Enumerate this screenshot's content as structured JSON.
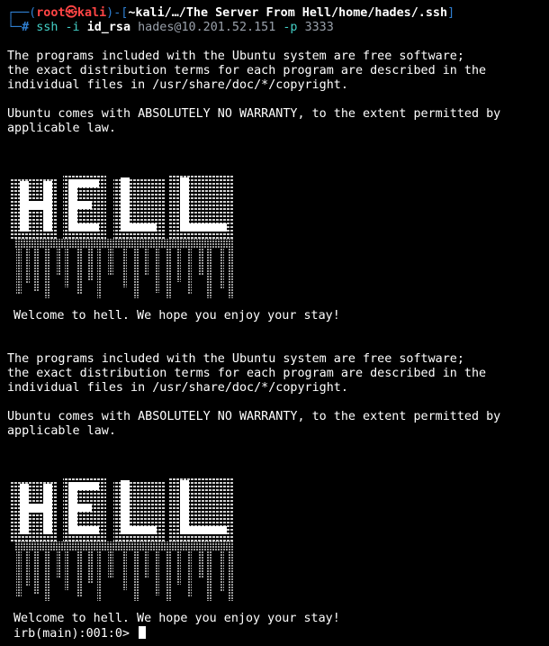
{
  "prompt": {
    "bracket_open": "┌──(",
    "user": "root㉿kali",
    "bracket_mid": ")-[",
    "path": "~kali/…/The Server From Hell/home/hades/.ssh",
    "bracket_close": "]",
    "second_line_prefix": "└─",
    "hash": "#",
    "command": "ssh",
    "flag_i": "-i",
    "key_file": "id_rsa",
    "target": "hades@10.201.52.151",
    "flag_p": "-p",
    "port": "3333"
  },
  "motd_1": {
    "line1": "The programs included with the Ubuntu system are free software;",
    "line2": "the exact distribution terms for each program are described in the",
    "line3": "individual files in /usr/share/doc/*/copyright.",
    "line4": "Ubuntu comes with ABSOLUTELY NO WARRANTY, to the extent permitted by",
    "line5": "applicable law."
  },
  "banner_1": {
    "text": "HELL",
    "welcome": "Welcome to hell. We hope you enjoy your stay!"
  },
  "motd_2": {
    "line1": "The programs included with the Ubuntu system are free software;",
    "line2": "the exact distribution terms for each program are described in the",
    "line3": "individual files in /usr/share/doc/*/copyright.",
    "line4": "Ubuntu comes with ABSOLUTELY NO WARRANTY, to the extent permitted by",
    "line5": "applicable law."
  },
  "banner_2": {
    "text": "HELL",
    "welcome": "Welcome to hell. We hope you enjoy your stay!"
  },
  "irb": {
    "prompt": "irb(main):001:0> "
  },
  "colors": {
    "background": "#000000",
    "foreground": "#ffffff",
    "prompt_blue": "#2f7fd1",
    "root_red": "#ff4545",
    "command_cyan": "#43d0c7",
    "dim_gray": "#9aa1ab"
  }
}
